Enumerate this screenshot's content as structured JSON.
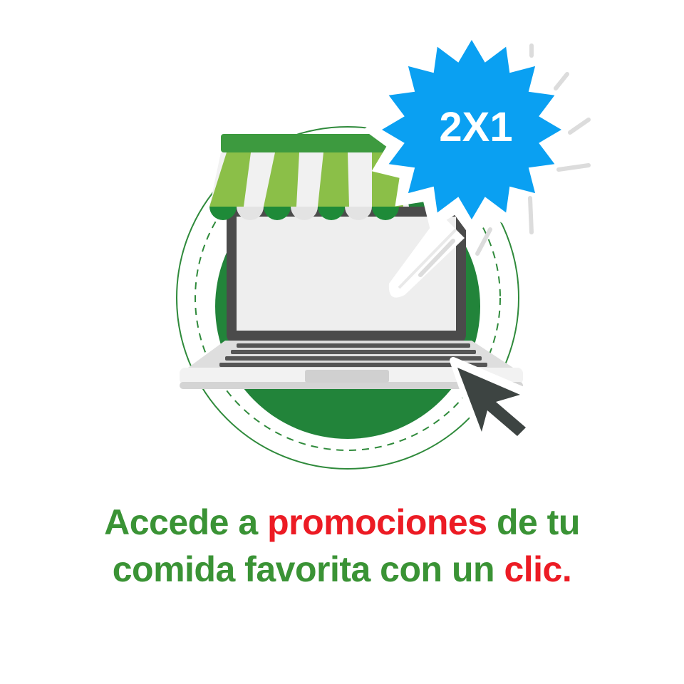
{
  "badge": {
    "text": "2X1",
    "color": "#0aa0f2"
  },
  "caption": {
    "line1": {
      "part1": "Accede a ",
      "highlight": "promociones",
      "part2": " de tu"
    },
    "line2": {
      "part1": "comida favorita con un ",
      "highlight": "clic."
    }
  },
  "colors": {
    "brand_green": "#3a9335",
    "accent_red": "#ec1b24",
    "circle_green": "#22843a",
    "awning_light_green": "#8bbf48",
    "awning_dark_green": "#1e8a38",
    "laptop_frame": "#4b4b4b",
    "cursor": "#3d4442"
  },
  "icons": [
    "storefront-awning-icon",
    "laptop-icon",
    "promo-starburst-icon",
    "mouse-cursor-icon"
  ]
}
